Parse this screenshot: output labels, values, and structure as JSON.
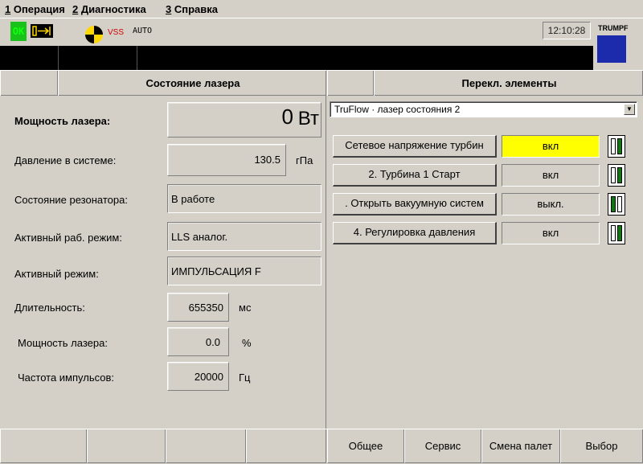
{
  "menu": {
    "items": [
      {
        "num": "1",
        "label": " Операция"
      },
      {
        "num": "2",
        "label": " Диагностика"
      },
      {
        "num": "3",
        "label": " Справка"
      }
    ]
  },
  "status": {
    "ok_label": "OK",
    "vss_label": "VSS",
    "auto_label": "AUTO",
    "time": "12:10:28",
    "brand": "TRUMPF"
  },
  "left": {
    "title": "Состояние лазера",
    "rows": [
      {
        "label": "Мощность лазера:",
        "value": "0",
        "unit": "Вт"
      },
      {
        "label": "Давление в системе:",
        "value": "130.5",
        "unit": "гПа"
      },
      {
        "label": "Состояние резонатора:",
        "value": "В работе"
      },
      {
        "label": "Активный раб. режим:",
        "value": "LLS аналог."
      },
      {
        "label": "Активный режим:",
        "value": "ИМПУЛЬСАЦИЯ F"
      },
      {
        "label": "Длительность:",
        "value": "655350",
        "unit": "мс"
      },
      {
        "label": "Мощность лазера:",
        "value": "0.0",
        "unit": "%"
      },
      {
        "label": "Частота импульсов:",
        "value": "20000",
        "unit": "Гц"
      }
    ]
  },
  "right": {
    "title": "Перекл. элементы",
    "dropdown_value": "TruFlow · лазер состояния 2",
    "switches": [
      {
        "label": "Сетевое напряжение турбин",
        "state": "вкл",
        "highlight": "#ffff00"
      },
      {
        "label": "2. Турбина 1 Старт",
        "state": "вкл"
      },
      {
        "label": ". Открыть вакуумную систем",
        "state": "выкл."
      },
      {
        "label": "4. Регулировка давления",
        "state": "вкл"
      }
    ]
  },
  "footer": {
    "keys": [
      "Общее",
      "Сервис",
      "Смена палет",
      "Выбор"
    ]
  },
  "colors": {
    "ok_green": "#19c219",
    "brand_blue": "#1b2bab",
    "indicator_green": "#0a7a0a",
    "state_highlight": "#ffff00"
  }
}
